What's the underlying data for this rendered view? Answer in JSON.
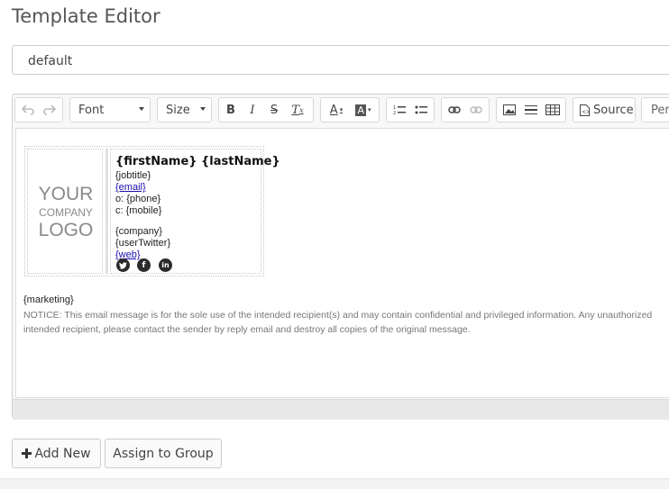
{
  "page": {
    "title": "Template Editor"
  },
  "template_select": {
    "value": "default"
  },
  "toolbar": {
    "font_label": "Font",
    "size_label": "Size",
    "source_label": "Source",
    "more_label": "Pers"
  },
  "signature": {
    "logo_line1": "YOUR",
    "logo_line2": "COMPANY",
    "logo_line3": "LOGO",
    "name": "{firstName} {lastName}",
    "jobtitle": "{jobtitle}",
    "email": "{email}",
    "phone": "o: {phone}",
    "mobile": "c: {mobile}",
    "company": "{company}",
    "twitter": "{userTwitter}",
    "web": "{web}"
  },
  "body": {
    "marketing": "{marketing}",
    "notice_line1": "NOTICE: This email message is for the sole use of the intended recipient(s) and may contain confidential and privileged information. Any unauthorized",
    "notice_line2": "intended recipient, please contact the sender by reply email and destroy all copies of the original message."
  },
  "buttons": {
    "add_new": "Add New",
    "assign_group": "Assign to Group"
  },
  "icons": [
    "undo-icon",
    "redo-icon",
    "bold-icon",
    "italic-icon",
    "strikethrough-icon",
    "remove-format-icon",
    "text-color-icon",
    "background-color-icon",
    "numbered-list-icon",
    "bulleted-list-icon",
    "link-icon",
    "unlink-icon",
    "image-icon",
    "horizontal-line-icon",
    "table-icon",
    "source-icon",
    "twitter-icon",
    "facebook-icon",
    "linkedin-icon",
    "plus-icon"
  ]
}
